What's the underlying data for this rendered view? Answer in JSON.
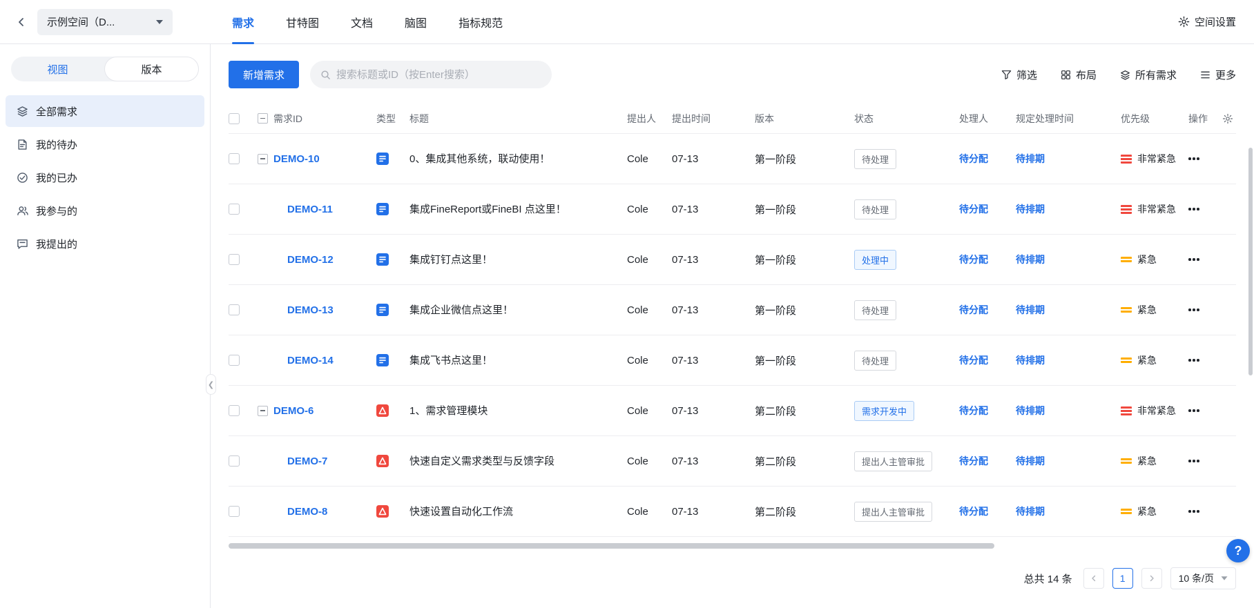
{
  "colors": {
    "accent": "#2270E8",
    "priority_high": "#F0483E",
    "priority_urgent": "#FFAE00"
  },
  "header": {
    "space_selector_label": "示例空间（D...",
    "tabs": [
      {
        "label": "需求",
        "active": true
      },
      {
        "label": "甘特图",
        "active": false
      },
      {
        "label": "文档",
        "active": false
      },
      {
        "label": "脑图",
        "active": false
      },
      {
        "label": "指标规范",
        "active": false
      }
    ],
    "settings_label": "空间设置"
  },
  "sidebar": {
    "segmented": {
      "left": "视图",
      "right": "版本",
      "active": "视图"
    },
    "items": [
      {
        "label": "全部需求",
        "icon": "layers-icon",
        "active": true
      },
      {
        "label": "我的待办",
        "icon": "document-icon",
        "active": false
      },
      {
        "label": "我的已办",
        "icon": "check-circle-icon",
        "active": false
      },
      {
        "label": "我参与的",
        "icon": "people-icon",
        "active": false
      },
      {
        "label": "我提出的",
        "icon": "comment-icon",
        "active": false
      }
    ]
  },
  "toolbar": {
    "new_button_label": "新增需求",
    "search_placeholder": "搜索标题或ID（按Enter搜索）",
    "actions": [
      {
        "label": "筛选",
        "icon": "filter-icon"
      },
      {
        "label": "布局",
        "icon": "layout-icon"
      },
      {
        "label": "所有需求",
        "icon": "stack-icon"
      },
      {
        "label": "更多",
        "icon": "list-icon"
      }
    ]
  },
  "table": {
    "columns": {
      "id": "需求ID",
      "type": "类型",
      "title": "标题",
      "proposer": "提出人",
      "proposed_time": "提出时间",
      "version": "版本",
      "status": "状态",
      "handler": "处理人",
      "scheduled_time": "规定处理时间",
      "priority": "优先级",
      "actions": "操作"
    },
    "rows": [
      {
        "id": "DEMO-10",
        "collapsible": true,
        "child": false,
        "type": "doc",
        "title": "0、集成其他系统，联动使用！",
        "proposer": "Cole",
        "proposed_time": "07-13",
        "version": "第一阶段",
        "status": "待处理",
        "status_style": "gray",
        "handler": "待分配",
        "scheduled_time": "待排期",
        "priority": "非常紧急",
        "priority_level": "red"
      },
      {
        "id": "DEMO-11",
        "collapsible": false,
        "child": true,
        "type": "doc",
        "title": "集成FineReport或FineBI 点这里！",
        "proposer": "Cole",
        "proposed_time": "07-13",
        "version": "第一阶段",
        "status": "待处理",
        "status_style": "gray",
        "handler": "待分配",
        "scheduled_time": "待排期",
        "priority": "非常紧急",
        "priority_level": "red"
      },
      {
        "id": "DEMO-12",
        "collapsible": false,
        "child": true,
        "type": "doc",
        "title": "集成钉钉点这里！",
        "proposer": "Cole",
        "proposed_time": "07-13",
        "version": "第一阶段",
        "status": "处理中",
        "status_style": "blue",
        "handler": "待分配",
        "scheduled_time": "待排期",
        "priority": "紧急",
        "priority_level": "orange"
      },
      {
        "id": "DEMO-13",
        "collapsible": false,
        "child": true,
        "type": "doc",
        "title": "集成企业微信点这里！",
        "proposer": "Cole",
        "proposed_time": "07-13",
        "version": "第一阶段",
        "status": "待处理",
        "status_style": "gray",
        "handler": "待分配",
        "scheduled_time": "待排期",
        "priority": "紧急",
        "priority_level": "orange"
      },
      {
        "id": "DEMO-14",
        "collapsible": false,
        "child": true,
        "type": "doc",
        "title": "集成飞书点这里！",
        "proposer": "Cole",
        "proposed_time": "07-13",
        "version": "第一阶段",
        "status": "待处理",
        "status_style": "gray",
        "handler": "待分配",
        "scheduled_time": "待排期",
        "priority": "紧急",
        "priority_level": "orange"
      },
      {
        "id": "DEMO-6",
        "collapsible": true,
        "child": false,
        "type": "task",
        "title": "1、需求管理模块",
        "proposer": "Cole",
        "proposed_time": "07-13",
        "version": "第二阶段",
        "status": "需求开发中",
        "status_style": "blue",
        "handler": "待分配",
        "scheduled_time": "待排期",
        "priority": "非常紧急",
        "priority_level": "red"
      },
      {
        "id": "DEMO-7",
        "collapsible": false,
        "child": true,
        "type": "task",
        "title": "快速自定义需求类型与反馈字段",
        "proposer": "Cole",
        "proposed_time": "07-13",
        "version": "第二阶段",
        "status": "提出人主管审批",
        "status_style": "gray",
        "handler": "待分配",
        "scheduled_time": "待排期",
        "priority": "紧急",
        "priority_level": "orange"
      },
      {
        "id": "DEMO-8",
        "collapsible": false,
        "child": true,
        "type": "task",
        "title": "快速设置自动化工作流",
        "proposer": "Cole",
        "proposed_time": "07-13",
        "version": "第二阶段",
        "status": "提出人主管审批",
        "status_style": "gray",
        "handler": "待分配",
        "scheduled_time": "待排期",
        "priority": "紧急",
        "priority_level": "orange"
      }
    ]
  },
  "pagination": {
    "total_label": "总共 14 条",
    "current_page": "1",
    "page_size_label": "10 条/页"
  },
  "help_label": "?"
}
